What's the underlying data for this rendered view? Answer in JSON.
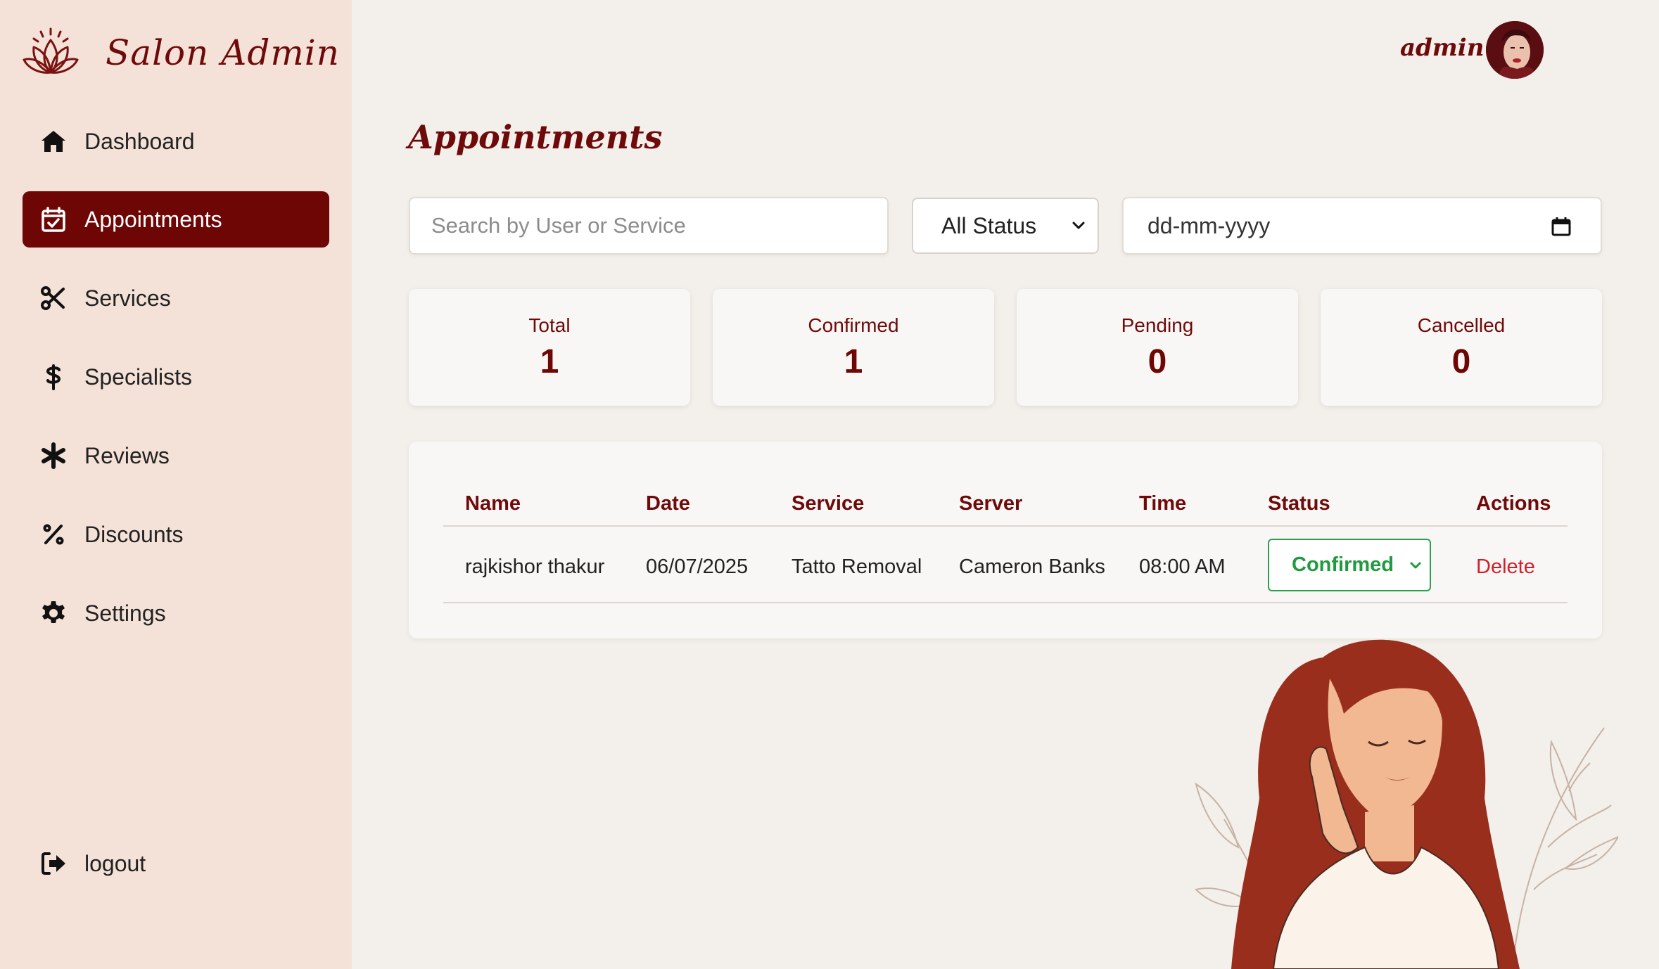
{
  "brand": {
    "name": "Salon Admin"
  },
  "sidebar": {
    "items": [
      {
        "label": "Dashboard",
        "icon": "home-icon"
      },
      {
        "label": "Appointments",
        "icon": "calendar-check-icon",
        "active": true
      },
      {
        "label": "Services",
        "icon": "scissors-icon"
      },
      {
        "label": "Specialists",
        "icon": "staff-snake-icon"
      },
      {
        "label": "Reviews",
        "icon": "asterisk-icon"
      },
      {
        "label": "Discounts",
        "icon": "percent-icon"
      },
      {
        "label": "Settings",
        "icon": "gear-icon"
      }
    ],
    "logout": {
      "label": "logout",
      "icon": "logout-icon"
    }
  },
  "topbar": {
    "user": "admin"
  },
  "page": {
    "title": "Appointments"
  },
  "filters": {
    "search_placeholder": "Search by User or Service",
    "status_value": "All Status",
    "date_placeholder": "dd-mm-yyyy"
  },
  "stats": [
    {
      "label": "Total",
      "value": "1"
    },
    {
      "label": "Confirmed",
      "value": "1"
    },
    {
      "label": "Pending",
      "value": "0"
    },
    {
      "label": "Cancelled",
      "value": "0"
    }
  ],
  "table": {
    "columns": [
      "Name",
      "Date",
      "Service",
      "Server",
      "Time",
      "Status",
      "Actions"
    ],
    "rows": [
      {
        "name": "rajkishor thakur",
        "date": "06/07/2025",
        "service": "Tatto Removal",
        "server": "Cameron Banks",
        "time": "08:00 AM",
        "status": "Confirmed",
        "action": "Delete"
      }
    ]
  },
  "colors": {
    "accent": "#6e0606",
    "sidebar_bg": "#f4e2d8",
    "page_bg": "#f3efea",
    "confirmed": "#1f9a3e",
    "delete": "#d0202a"
  }
}
